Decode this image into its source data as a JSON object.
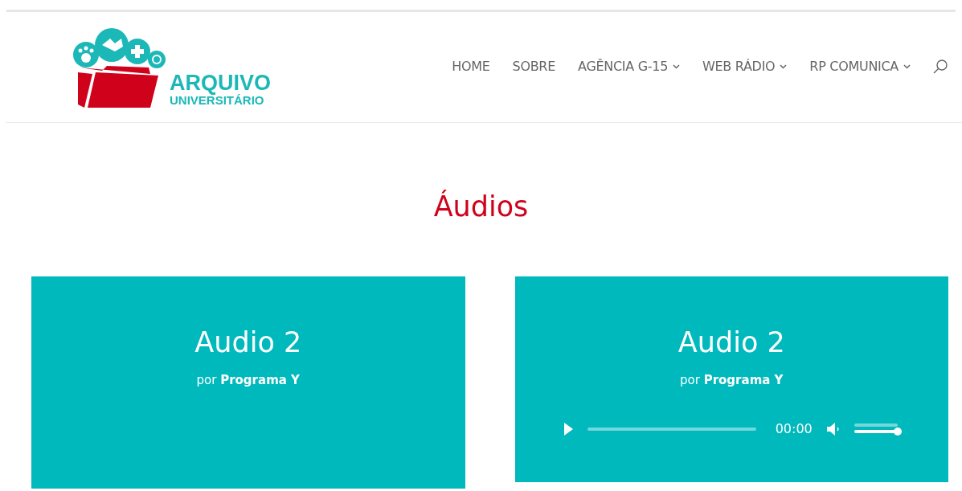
{
  "logo": {
    "line1": "ARQUIVO",
    "line2": "UNIVERSITÁRIO"
  },
  "nav": [
    {
      "label": "HOME",
      "dropdown": false
    },
    {
      "label": "SOBRE",
      "dropdown": false
    },
    {
      "label": "AGÊNCIA G-15",
      "dropdown": true
    },
    {
      "label": "WEB RÁDIO",
      "dropdown": true
    },
    {
      "label": "RP COMUNICA",
      "dropdown": true
    }
  ],
  "heading": "Áudios",
  "cards": [
    {
      "title": "Audio 2",
      "byline": "por **Programa Y**"
    },
    {
      "title": "Audio 2",
      "byline": "por **Programa Y**",
      "player": {
        "time": "00:00",
        "progress": {
          "level": 0
        },
        "volume": {
          "level": 1
        }
      }
    }
  ]
}
